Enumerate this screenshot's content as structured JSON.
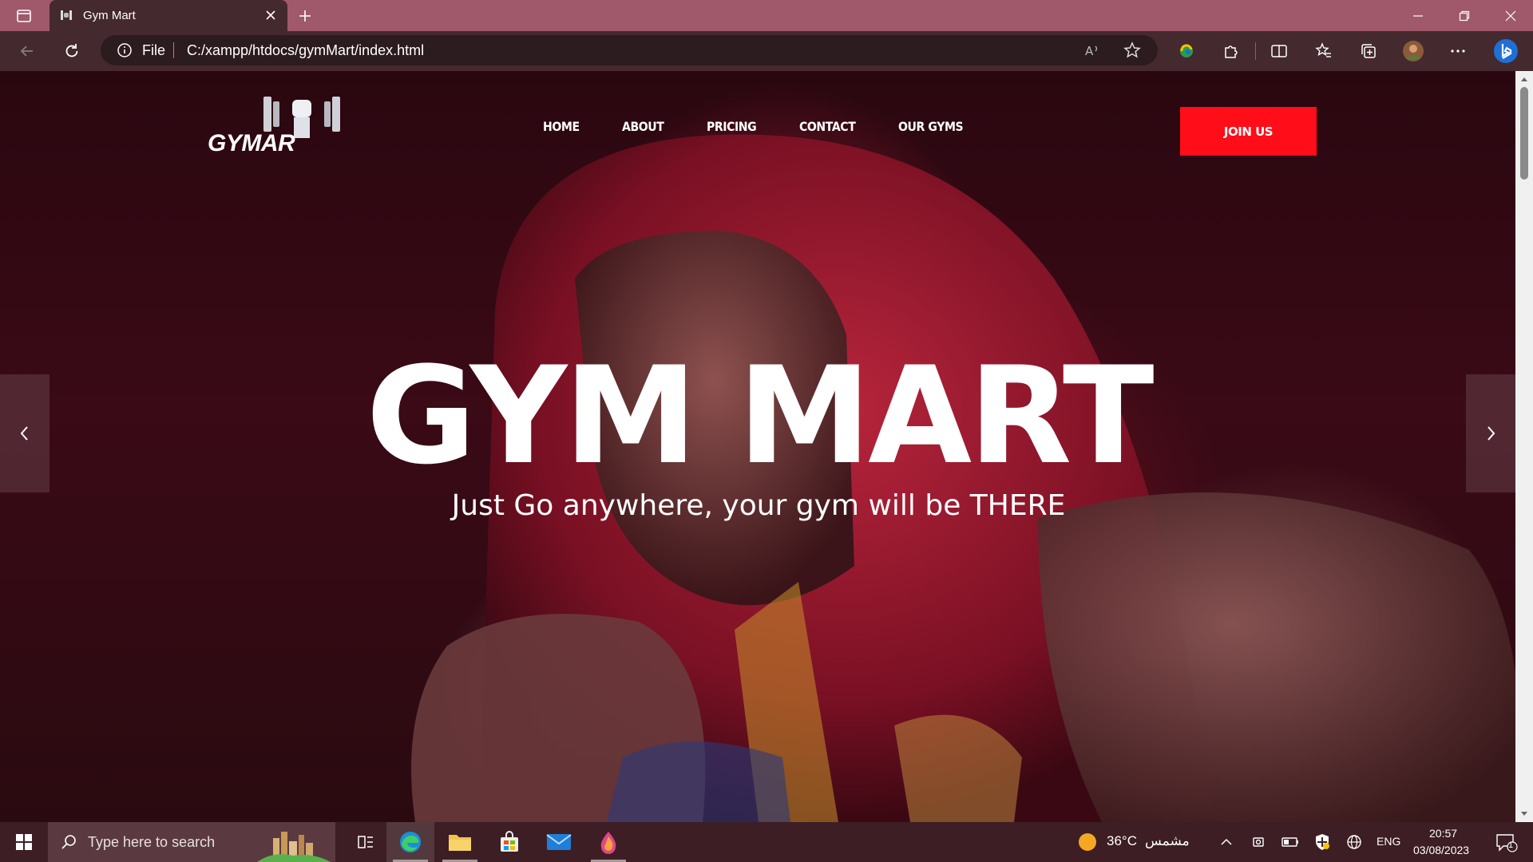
{
  "browser": {
    "tab": {
      "title": "Gym Mart"
    },
    "address": {
      "scheme_label": "File",
      "url": "C:/xampp/htdocs/gymMart/index.html"
    }
  },
  "site": {
    "logo_text": "GYMAR",
    "nav": [
      {
        "label": "HOME"
      },
      {
        "label": "ABOUT"
      },
      {
        "label": "PRICING"
      },
      {
        "label": "CONTACT"
      },
      {
        "label": "OUR GYMS"
      }
    ],
    "join_label": "JOIN US",
    "hero": {
      "title": "GYM MART",
      "subtitle": "Just Go anywhere, your gym will be THERE"
    }
  },
  "taskbar": {
    "search_placeholder": "Type here to search",
    "weather": {
      "temp": "36°C",
      "condition": "مشمس"
    },
    "language": "ENG",
    "time": "20:57",
    "date": "03/08/2023",
    "notification_count": "1"
  },
  "colors": {
    "titlebar": "#a0596a",
    "tab": "#44292f",
    "accent_red": "#ff0d19",
    "taskbar": "#3c1e24"
  }
}
